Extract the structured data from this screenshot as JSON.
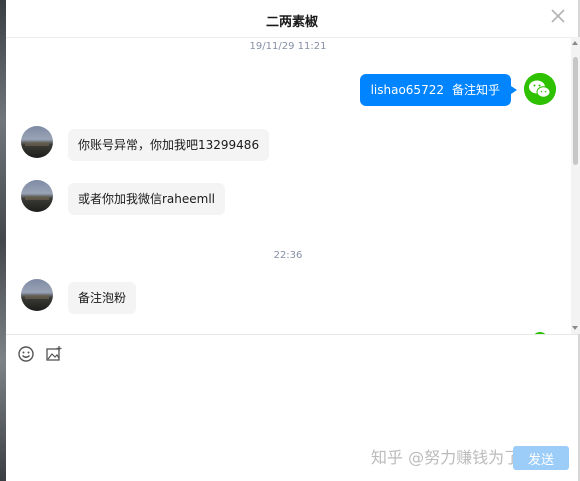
{
  "window": {
    "title": "二两素椒"
  },
  "messages": {
    "timestamp_1": "19/11/29 11:21",
    "outgoing_1": {
      "part_1": "lishao65722",
      "part_2": "备注知乎"
    },
    "incoming_1": "你账号异常，你加我吧13299486",
    "incoming_2": "或者你加我微信raheemll",
    "timestamp_2": "22:36",
    "incoming_3": "备注泡粉"
  },
  "input": {
    "watermark": "知乎 @努力赚钱为了明天",
    "send_label": "发送"
  },
  "colors": {
    "outgoing_bubble": "#0084ff",
    "incoming_bubble": "#f4f4f4",
    "wechat_green": "#2dc100",
    "send_button": "#9ccdf8"
  },
  "icons": [
    "close-icon",
    "wechat-icon",
    "emoji-icon",
    "image-icon"
  ]
}
